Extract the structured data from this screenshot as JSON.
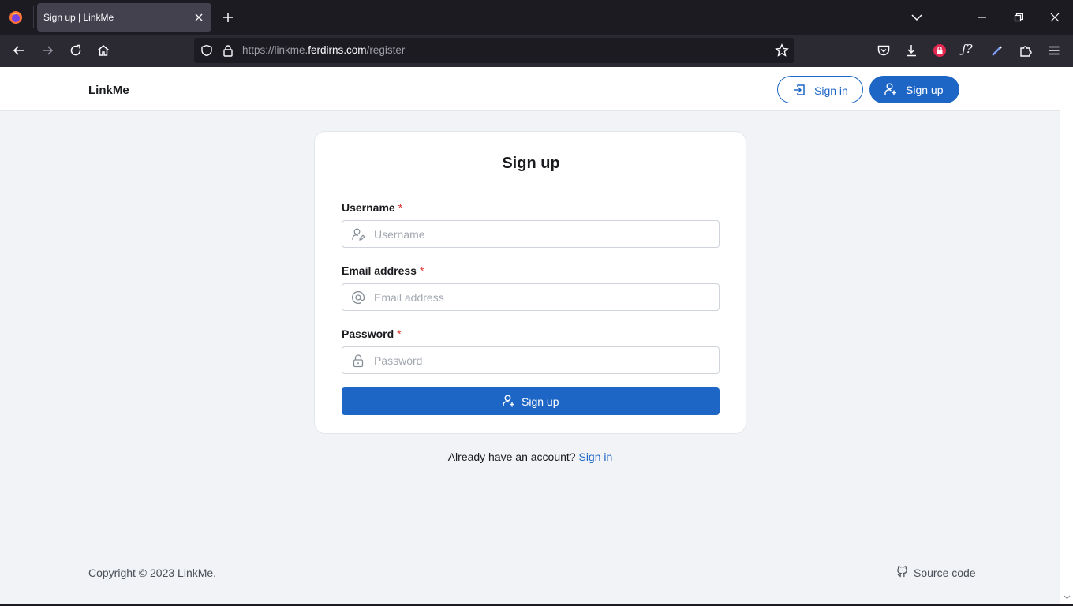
{
  "browser": {
    "tab_title": "Sign up | LinkMe",
    "url_prefix": "https://linkme.",
    "url_domain": "ferdirns.com",
    "url_path": "/register"
  },
  "header": {
    "brand": "LinkMe",
    "sign_in_label": "Sign in",
    "sign_up_label": "Sign up"
  },
  "form": {
    "title": "Sign up",
    "required_mark": "*",
    "username": {
      "label": "Username",
      "placeholder": "Username",
      "value": ""
    },
    "email": {
      "label": "Email address",
      "placeholder": "Email address",
      "value": ""
    },
    "password": {
      "label": "Password",
      "placeholder": "Password",
      "value": ""
    },
    "submit_label": "Sign up"
  },
  "footer_prompt": {
    "text": "Already have an account? ",
    "link": "Sign in"
  },
  "footer": {
    "copyright": "Copyright © 2023 LinkMe.",
    "source_label": "Source code"
  },
  "colors": {
    "accent": "#1e66c5",
    "page_bg": "#f1f3f7",
    "required": "#e03131"
  },
  "icons": {
    "sign_in": "login-icon",
    "sign_up": "user-plus-icon",
    "username": "user-edit-icon",
    "email": "at-icon",
    "password": "lock-icon",
    "source": "github-icon"
  }
}
